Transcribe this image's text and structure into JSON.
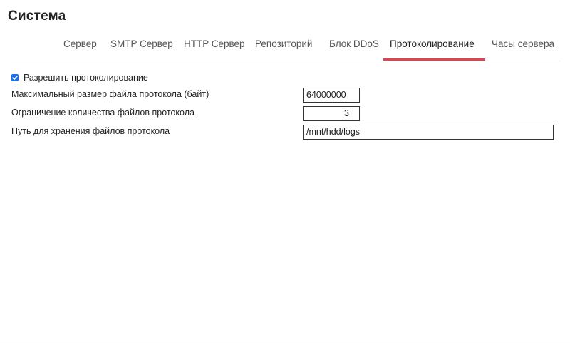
{
  "page": {
    "title": "Система"
  },
  "tabs": [
    {
      "label": "Сервер"
    },
    {
      "label": "SMTP Сервер"
    },
    {
      "label": "HTTP Сервер"
    },
    {
      "label": "Репозиторий"
    },
    {
      "label": "Блок DDoS"
    },
    {
      "label": "Протоколирование",
      "active": true
    },
    {
      "label": "Часы сервера"
    }
  ],
  "form": {
    "enable_logging": {
      "label": "Разрешить протоколирование",
      "checked": true
    },
    "max_file_size": {
      "label": "Максимальный размер файла протокола (байт)",
      "value": "64000000"
    },
    "max_file_count": {
      "label": "Ограничение количества файлов протокола",
      "value": "3"
    },
    "log_path": {
      "label": "Путь для хранения файлов протокола",
      "value": "/mnt/hdd/logs"
    }
  },
  "colors": {
    "accent": "#e0424f",
    "checkbox": "#1a73e8"
  }
}
